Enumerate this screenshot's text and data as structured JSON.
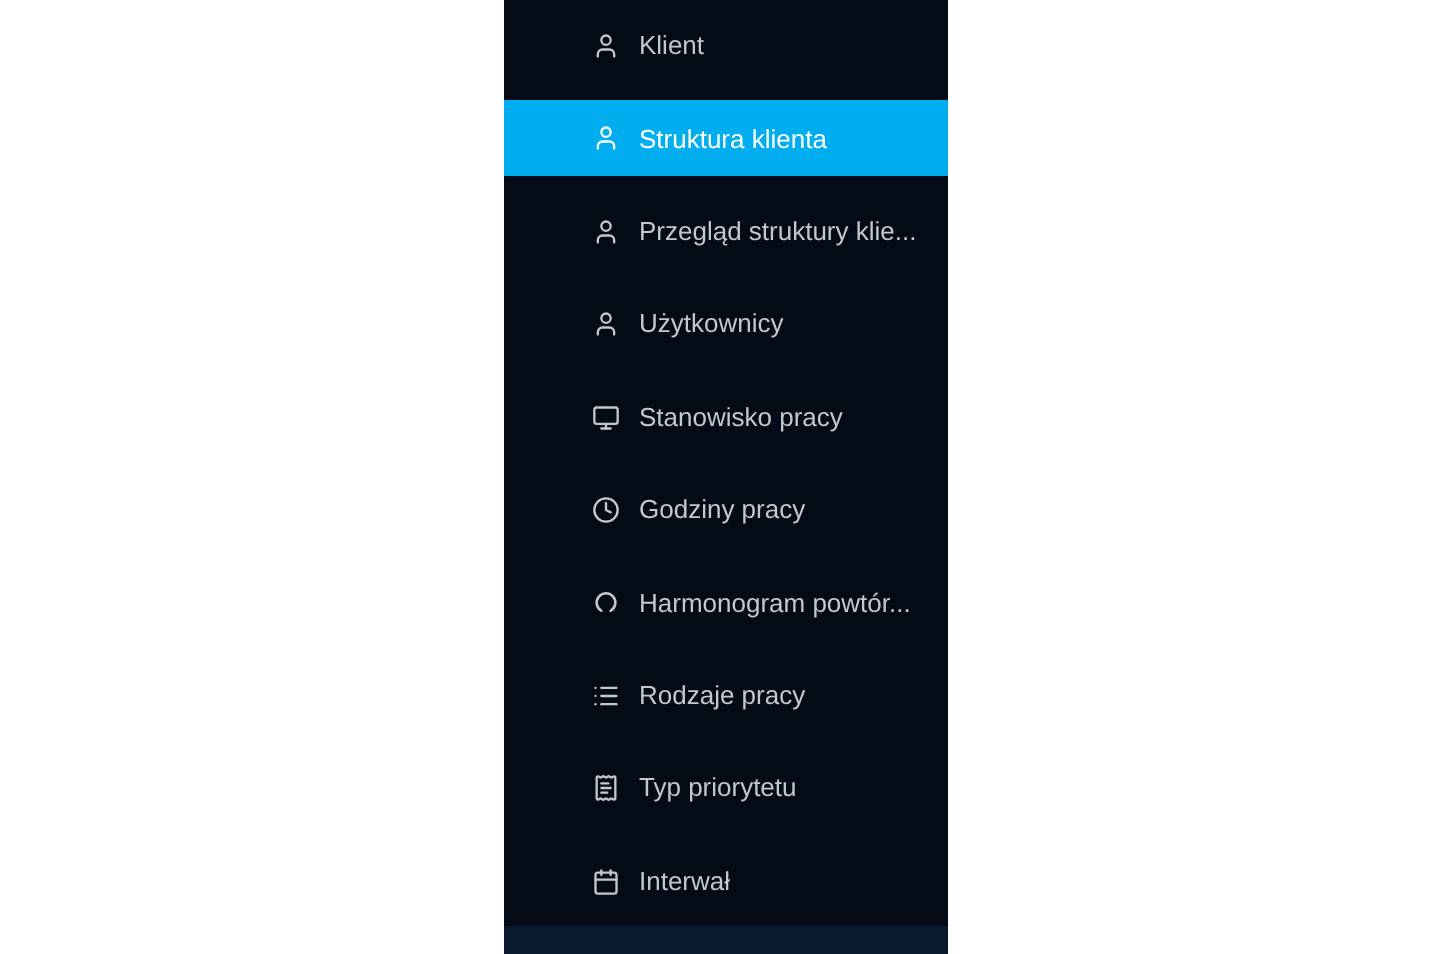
{
  "sidebar": {
    "items": [
      {
        "label": "Klient",
        "kind": "user",
        "selected": false
      },
      {
        "label": "Struktura klienta",
        "kind": "user",
        "selected": true
      },
      {
        "label": "Przegląd struktury klie...",
        "kind": "user",
        "selected": false
      },
      {
        "label": "Użytkownicy",
        "kind": "user",
        "selected": false
      },
      {
        "label": "Stanowisko pracy",
        "kind": "monitor",
        "selected": false
      },
      {
        "label": "Godziny pracy",
        "kind": "clock",
        "selected": false
      },
      {
        "label": "Harmonogram powtór...",
        "kind": "cycle",
        "selected": false
      },
      {
        "label": "Rodzaje pracy",
        "kind": "list",
        "selected": false
      },
      {
        "label": "Typ priorytetu",
        "kind": "document",
        "selected": false
      },
      {
        "label": "Interwał",
        "kind": "calendar",
        "selected": false
      }
    ]
  }
}
